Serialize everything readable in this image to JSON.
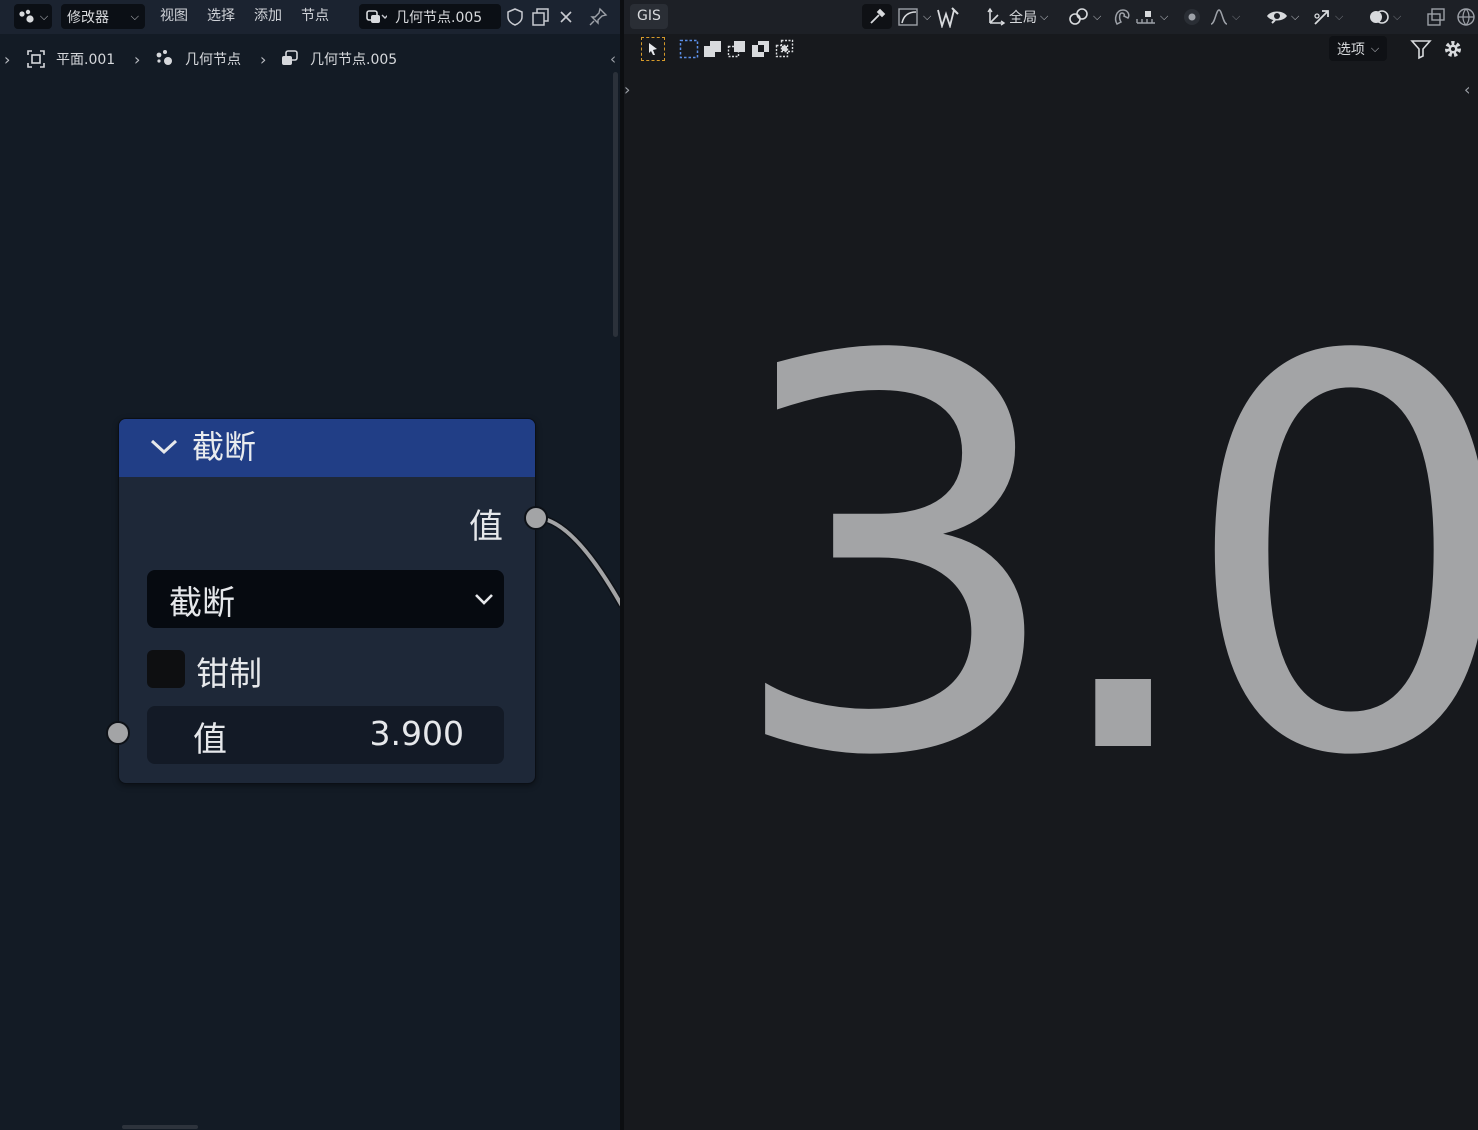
{
  "node_editor": {
    "header": {
      "editor_type_icon": "node-editor-icon",
      "context_label": "修改器",
      "menus": [
        "视图",
        "选择",
        "添加",
        "节点"
      ],
      "node_group_name": "几何节点.005"
    },
    "breadcrumb": [
      "平面.001",
      "几何节点",
      "几何节点.005"
    ],
    "node": {
      "title": "截断",
      "output_label": "值",
      "mode_label": "截断",
      "clamp_label": "钳制",
      "clamp_checked": false,
      "input_label": "值",
      "input_value": "3.900"
    }
  },
  "viewer": {
    "tab_label": "GIS",
    "transform_orientation": "全局",
    "options_label": "选项",
    "display_value": "3.0"
  },
  "colors": {
    "node_header": "#213e86",
    "node_body": "#1e2838",
    "socket": "#a3a4a6",
    "viewer_text": "#a3a4a6"
  }
}
